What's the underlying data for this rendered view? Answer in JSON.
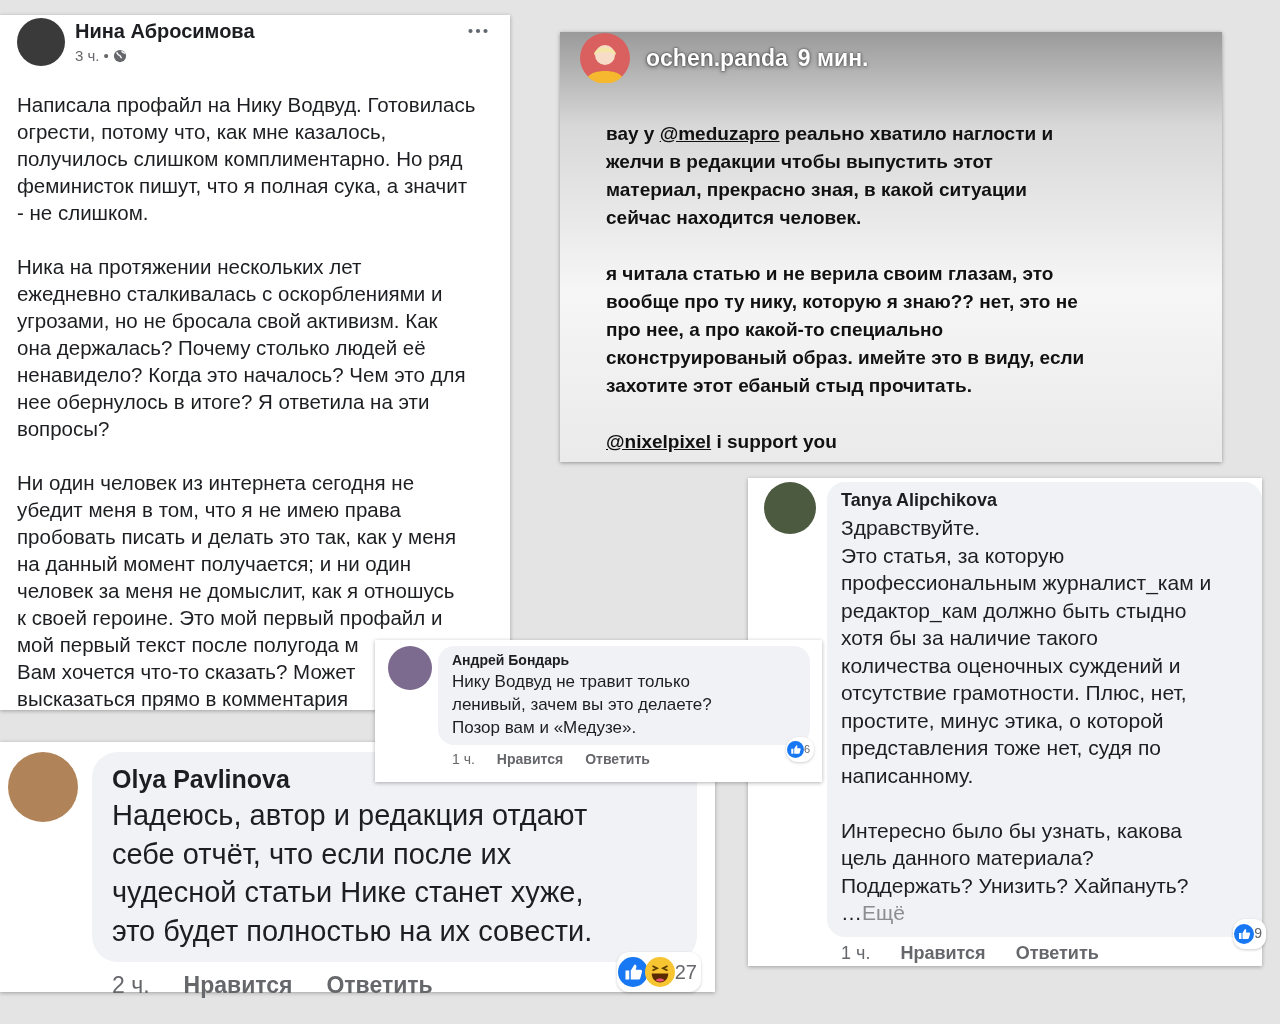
{
  "post": {
    "author": "Нина Абросимова",
    "time": "3 ч.",
    "separator": "•",
    "paragraphs": [
      [
        "Написала профайл на Нику Водвуд. Готовилась",
        "огрести, потому что, как мне казалось,",
        "получилось слишком комплиментарно. Но ряд",
        "феминисток пишут, что я полная сука, а значит",
        "- не слишком."
      ],
      [
        "Ника на протяжении нескольких лет",
        "ежедневно сталкивалась с оскорблениями и",
        "угрозами, но не бросала свой активизм. Как",
        "она держалась? Почему столько людей её",
        "ненавидело? Когда это началось? Чем это для",
        "нее обернулось в итоге? Я ответила на эти",
        "вопросы?"
      ],
      [
        "Ни один человек из интернета сегодня не",
        "убедит меня в том, что я не имею права",
        "пробовать писать и делать это так, как у меня",
        "на данный момент получается; и ни один",
        "человек за меня не домыслит, как я отношусь",
        "к своей героине. Это мой первый профайл и",
        "мой первый текст после полугода м",
        "Вам хочется что-то сказать? Может",
        "высказаться прямо в комментария"
      ]
    ]
  },
  "story": {
    "username": "ochen.panda",
    "time": "9 мин.",
    "paragraphs": [
      [
        [
          {
            "kind": "plain",
            "text": "вау у "
          },
          {
            "kind": "mention",
            "text": "@meduzapro"
          },
          {
            "kind": "plain",
            "text": " реально хватило наглости и"
          }
        ],
        [
          {
            "kind": "plain",
            "text": "желчи в редакции чтобы выпустить этот"
          }
        ],
        [
          {
            "kind": "plain",
            "text": "материал, прекрасно зная, в какой ситуации"
          }
        ],
        [
          {
            "kind": "plain",
            "text": "сейчас находится человек."
          }
        ]
      ],
      [
        [
          {
            "kind": "plain",
            "text": "я читала статью и не верила своим глазам, это"
          }
        ],
        [
          {
            "kind": "plain",
            "text": "вообще про ту нику, которую я знаю?? нет, это не"
          }
        ],
        [
          {
            "kind": "plain",
            "text": "про нее, а про какой-то специально"
          }
        ],
        [
          {
            "kind": "plain",
            "text": "сконструированый образ. имейте это в виду, если"
          }
        ],
        [
          {
            "kind": "plain",
            "text": "захотите этот ебаный стыд прочитать."
          }
        ]
      ],
      [
        [
          {
            "kind": "mention",
            "text": "@nixelpixel"
          },
          {
            "kind": "plain",
            "text": " i support you"
          }
        ]
      ]
    ]
  },
  "comments": [
    {
      "author": "Tanya Alipchikova",
      "paragraphs": [
        [
          "Здравствуйте.",
          "Это статья, за которую",
          "профессиональным журналист_кам и",
          "редактор_кам должно быть стыдно",
          "хотя бы за наличие такого",
          "количества оценочных суждений и",
          "отсутствие грамотности. Плюс, нет,",
          "простите, минус этика, о которой",
          "представления тоже нет, судя по",
          "написанному."
        ],
        [
          "Интересно было бы узнать, какова",
          "цель данного материала?",
          "Поддержать? Унизить? Хайпануть?"
        ]
      ],
      "more": {
        "ellipsis": "…",
        "label": "Ещё"
      },
      "time": "1 ч.",
      "like": "Нравится",
      "reply": "Ответить",
      "reactions": {
        "icons": [
          {
            "kind": "like"
          }
        ],
        "count": "9"
      }
    },
    {
      "author": "Андрей Бондарь",
      "paragraphs": [
        [
          "Нику Водвуд не травит только",
          "ленивый, зачем вы это делаете?",
          "Позор вам и «Медузе»."
        ]
      ],
      "time": "1 ч.",
      "like": "Нравится",
      "reply": "Ответить",
      "reactions": {
        "icons": [
          {
            "kind": "like"
          }
        ],
        "count": "6"
      }
    },
    {
      "author": "Olya Pavlinova",
      "paragraphs": [
        [
          "Надеюсь, автор и редакция отдают",
          "себе отчёт, что если после их",
          "чудесной статьи Нике станет хуже,",
          "это будет полностью на их совести."
        ]
      ],
      "time": "2 ч.",
      "like": "Нравится",
      "reply": "Ответить",
      "reactions": {
        "icons": [
          {
            "kind": "like"
          },
          {
            "kind": "haha"
          }
        ],
        "count": "27"
      }
    }
  ]
}
